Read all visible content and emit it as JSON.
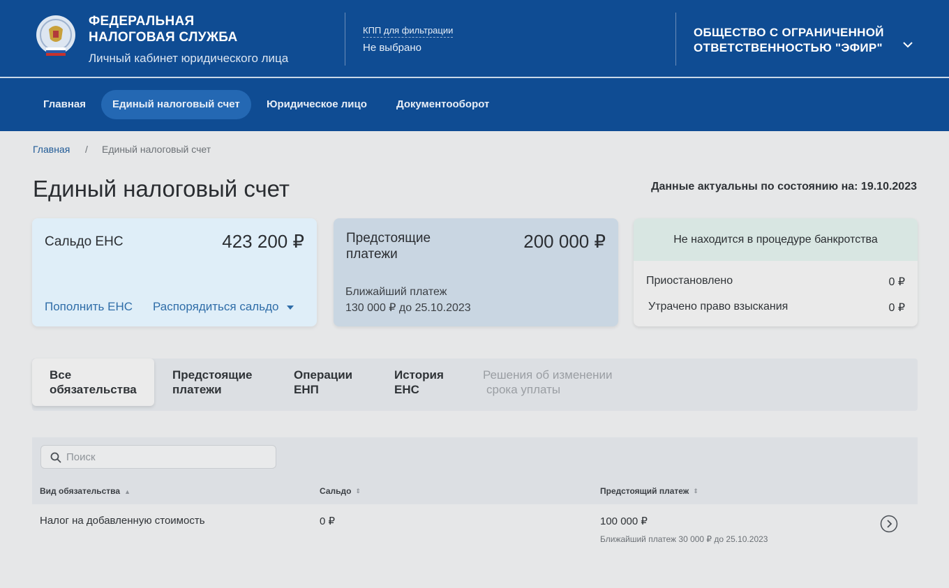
{
  "header": {
    "brand_title": "Федеральная налоговая служба",
    "brand_subtitle": "Личный кабинет юридического лица",
    "kpp_label": "КПП для фильтрации",
    "kpp_value": "Не выбрано",
    "org_name": "Общество с ограниченной ответственностью \"ЭФИР\"",
    "colors": {
      "primary": "#0f4c93",
      "nav_active": "#2468b3",
      "link": "#2f6da8"
    }
  },
  "nav": {
    "items": [
      {
        "label": "Главная",
        "active": false
      },
      {
        "label": "Единый налоговый счет",
        "active": true
      },
      {
        "label": "Юридическое лицо",
        "active": false
      },
      {
        "label": "Документооборот",
        "active": false
      }
    ]
  },
  "breadcrumb": {
    "home": "Главная",
    "separator": "/",
    "current": "Единый налоговый счет"
  },
  "page": {
    "title": "Единый налоговый счет",
    "actual_date": "Данные актуальны по состоянию на: 19.10.2023"
  },
  "cards": {
    "balance": {
      "label": "Сальдо ЕНС",
      "amount": "423 200 ₽",
      "topup_link": "Пополнить ЕНС",
      "manage_link": "Распорядиться сальдо"
    },
    "upcoming": {
      "label": "Предстоящие платежи",
      "amount": "200 000 ₽",
      "nearest_label": "Ближайший платеж",
      "nearest_value": "130 000 ₽ до 25.10.2023"
    },
    "status": {
      "headline": "Не находится в процедуре банкротства",
      "rows": [
        {
          "label": "Приостановлено",
          "value": "0 ₽"
        },
        {
          "label": "Утрачено право взыскания",
          "value": "0 ₽"
        }
      ]
    }
  },
  "tabs": [
    {
      "line1": "Все",
      "line2": "обязательства",
      "active": true,
      "disabled": false
    },
    {
      "line1": "Предстоящие",
      "line2": "платежи",
      "active": false,
      "disabled": false
    },
    {
      "line1": "Операции",
      "line2": "ЕНП",
      "active": false,
      "disabled": false
    },
    {
      "line1": "История",
      "line2": "ЕНС",
      "active": false,
      "disabled": false
    },
    {
      "line1": "Решения об изменении",
      "line2": "срока уплаты",
      "active": false,
      "disabled": true
    }
  ],
  "table": {
    "search_placeholder": "Поиск",
    "columns": [
      "Вид обязательства",
      "Сальдо",
      "Предстоящий платеж"
    ],
    "rows": [
      {
        "type": "Налог на добавленную стоимость",
        "balance": "0 ₽",
        "upcoming": "100 000 ₽",
        "upcoming_note": "Ближайший платеж 30 000 ₽ до 25.10.2023"
      }
    ]
  }
}
